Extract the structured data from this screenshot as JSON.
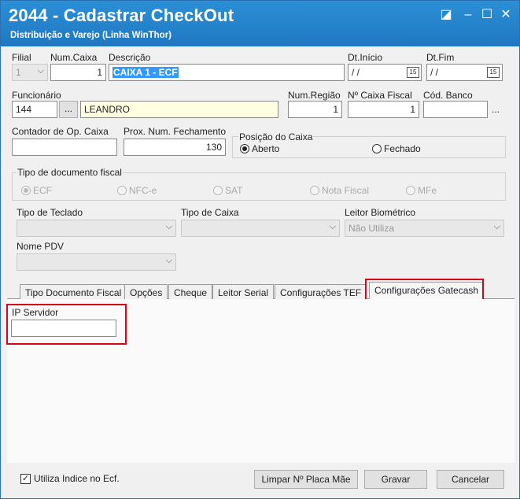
{
  "window": {
    "title": "2044 - Cadastrar CheckOut",
    "subtitle": "Distribuição e Varejo (Linha WinThor)"
  },
  "fields": {
    "filial": {
      "label": "Filial",
      "value": "1"
    },
    "num_caixa": {
      "label": "Num.Caixa",
      "value": "1"
    },
    "descricao": {
      "label": "Descrição",
      "value": "CAIXA 1 - ECF"
    },
    "dt_inicio": {
      "label": "Dt.Início",
      "value": " / /"
    },
    "dt_fim": {
      "label": "Dt.Fim",
      "value": " / /"
    },
    "funcionario": {
      "label": "Funcionário",
      "code": "144",
      "name": "LEANDRO"
    },
    "num_regiao": {
      "label": "Num.Região",
      "value": "1"
    },
    "num_caixa_fiscal": {
      "label": "Nº Caixa Fiscal",
      "value": "1"
    },
    "cod_banco": {
      "label": "Cód. Banco",
      "value": ""
    },
    "contador_op": {
      "label": "Contador de Op. Caixa",
      "value": ""
    },
    "prox_num_fechamento": {
      "label": "Prox. Num. Fechamento",
      "value": "130"
    },
    "posicao_caixa": {
      "label": "Posição do Caixa",
      "options": [
        "Aberto",
        "Fechado"
      ],
      "selected": "Aberto"
    },
    "tipo_documento_fiscal": {
      "label": "Tipo de documento fiscal",
      "options": [
        "ECF",
        "NFC-e",
        "SAT",
        "Nota Fiscal",
        "MFe"
      ],
      "selected": "ECF"
    },
    "tipo_teclado": {
      "label": "Tipo de Teclado",
      "value": ""
    },
    "tipo_caixa": {
      "label": "Tipo de Caixa",
      "value": ""
    },
    "leitor_biometrico": {
      "label": "Leitor Biométrico",
      "value": "Não Utiliza"
    },
    "nome_pdv": {
      "label": "Nome PDV",
      "value": ""
    }
  },
  "tabs": [
    {
      "label": "Tipo Documento Fiscal"
    },
    {
      "label": "Opções"
    },
    {
      "label": "Cheque"
    },
    {
      "label": "Leitor Serial"
    },
    {
      "label": "Configurações TEF"
    },
    {
      "label": "Configurações Gatecash"
    }
  ],
  "active_tab": "Configurações Gatecash",
  "gatecash": {
    "ip_servidor_label": "IP Servidor",
    "ip_servidor_value": ""
  },
  "footer": {
    "utiliza_indice_label": "Utiliza Indice no Ecf.",
    "utiliza_indice_checked": true,
    "limpar_label": "Limpar Nº Placa Mãe",
    "gravar_label": "Gravar",
    "cancelar_label": "Cancelar"
  },
  "colors": {
    "titlebar": "#1f78c1",
    "highlight": "#e0001a",
    "selection": "#3399ff"
  }
}
